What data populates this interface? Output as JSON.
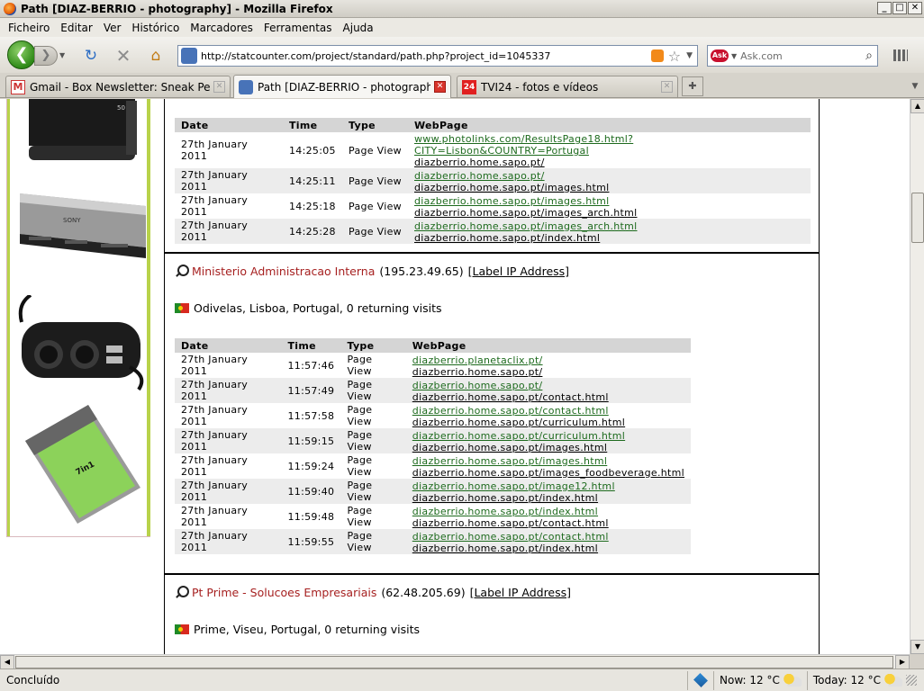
{
  "window": {
    "title": "Path [DIAZ-BERRIO - photography] - Mozilla Firefox",
    "buttons": [
      "_",
      "□",
      "✕"
    ]
  },
  "menu": [
    "Ficheiro",
    "Editar",
    "Ver",
    "Histórico",
    "Marcadores",
    "Ferramentas",
    "Ajuda"
  ],
  "nav": {
    "back_icon": "back-arrow-icon",
    "forward_icon": "forward-arrow-icon",
    "url": "http://statcounter.com/project/standard/path.php?project_id=1045337",
    "search_placeholder": "Ask.com",
    "search_engine_label": "Ask"
  },
  "tabs": [
    {
      "label": "Gmail - Box Newsletter: Sneak Peek at ...",
      "active": false,
      "icon": "gmail-icon"
    },
    {
      "label": "Path [DIAZ-BERRIO - photography]",
      "active": true,
      "icon": "statcounter-icon"
    },
    {
      "label": "TVI24 - fotos e vídeos",
      "active": false,
      "icon": "tvi24-icon"
    }
  ],
  "table_headers": [
    "Date",
    "Time",
    "Type",
    "WebPage"
  ],
  "visit_top": {
    "rows": [
      {
        "date": "27th January 2011",
        "time": "14:25:05",
        "type": "Page View",
        "from": "www.photolinks.com/ResultsPage18.html?CITY=Lisbon&COUNTRY=Portugal",
        "to": "diazberrio.home.sapo.pt/"
      },
      {
        "date": "27th January 2011",
        "time": "14:25:11",
        "type": "Page View",
        "from": "diazberrio.home.sapo.pt/",
        "to": "diazberrio.home.sapo.pt/images.html"
      },
      {
        "date": "27th January 2011",
        "time": "14:25:18",
        "type": "Page View",
        "from": "diazberrio.home.sapo.pt/images.html",
        "to": "diazberrio.home.sapo.pt/images_arch.html"
      },
      {
        "date": "27th January 2011",
        "time": "14:25:28",
        "type": "Page View",
        "from": "diazberrio.home.sapo.pt/images_arch.html",
        "to": "diazberrio.home.sapo.pt/index.html"
      }
    ]
  },
  "visit_2": {
    "org": "Ministerio Administracao Interna",
    "ip": "(195.23.49.65)",
    "label_link": "[Label IP Address]",
    "location": "Odivelas, Lisboa, Portugal, 0 returning visits",
    "rows": [
      {
        "date": "27th January 2011",
        "time": "11:57:46",
        "type": "Page View",
        "from": "diazberrio.planetaclix.pt/",
        "to": "diazberrio.home.sapo.pt/"
      },
      {
        "date": "27th January 2011",
        "time": "11:57:49",
        "type": "Page View",
        "from": "diazberrio.home.sapo.pt/",
        "to": "diazberrio.home.sapo.pt/contact.html"
      },
      {
        "date": "27th January 2011",
        "time": "11:57:58",
        "type": "Page View",
        "from": "diazberrio.home.sapo.pt/contact.html",
        "to": "diazberrio.home.sapo.pt/curriculum.html"
      },
      {
        "date": "27th January 2011",
        "time": "11:59:15",
        "type": "Page View",
        "from": "diazberrio.home.sapo.pt/curriculum.html",
        "to": "diazberrio.home.sapo.pt/images.html"
      },
      {
        "date": "27th January 2011",
        "time": "11:59:24",
        "type": "Page View",
        "from": "diazberrio.home.sapo.pt/images.html",
        "to": "diazberrio.home.sapo.pt/images_foodbeverage.html"
      },
      {
        "date": "27th January 2011",
        "time": "11:59:40",
        "type": "Page View",
        "from": "diazberrio.home.sapo.pt/image12.html",
        "to": "diazberrio.home.sapo.pt/index.html"
      },
      {
        "date": "27th January 2011",
        "time": "11:59:48",
        "type": "Page View",
        "from": "diazberrio.home.sapo.pt/index.html",
        "to": "diazberrio.home.sapo.pt/contact.html"
      },
      {
        "date": "27th January 2011",
        "time": "11:59:55",
        "type": "Page View",
        "from": "diazberrio.home.sapo.pt/contact.html",
        "to": "diazberrio.home.sapo.pt/index.html"
      }
    ]
  },
  "visit_3": {
    "org": "Pt Prime - Solucoes Empresariais",
    "ip": "(62.48.205.69)",
    "label_link": "[Label IP Address]",
    "location": "Prime, Viseu, Portugal, 0 returning visits"
  },
  "sidebar_products": {
    "card_reader_brand": "SONY",
    "expresscard_text": "7in1"
  },
  "status": {
    "text": "Concluído",
    "now": "Now: 12 °C",
    "today": "Today: 12 °C"
  }
}
